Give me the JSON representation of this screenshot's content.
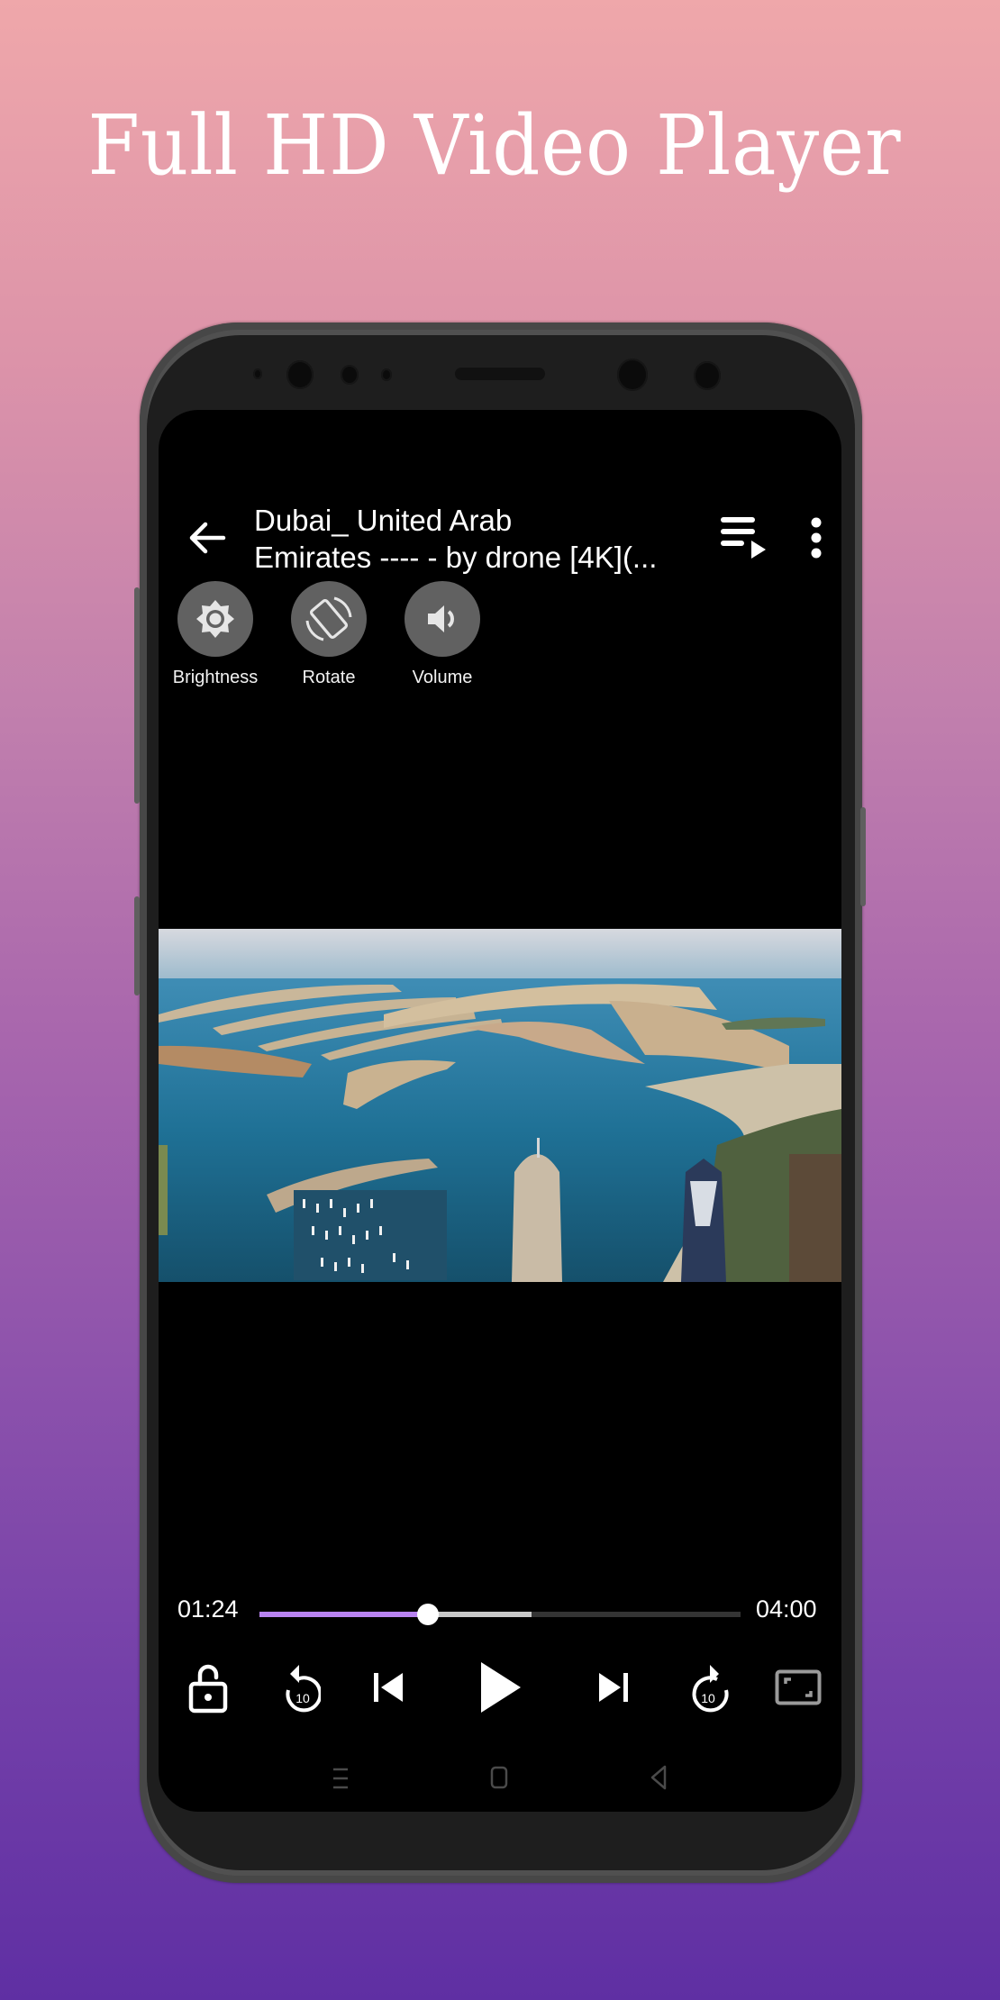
{
  "promo": {
    "headline": "Full HD Video Player"
  },
  "player": {
    "title_line1": "Dubai_ United Arab",
    "title_line2": "Emirates ---- - by drone [4K](...",
    "quick_actions": [
      {
        "label": "Brightness",
        "icon": "brightness-icon"
      },
      {
        "label": "Rotate",
        "icon": "rotate-icon"
      },
      {
        "label": "Volume",
        "icon": "volume-icon"
      }
    ],
    "video": {
      "description": "Aerial drone view of Palm Jumeirah and Dubai Marina"
    },
    "progress": {
      "current_time": "01:24",
      "total_time": "04:00",
      "played_fraction": 0.35,
      "buffered_fraction": 0.565
    },
    "controls": [
      {
        "name": "lock",
        "icon": "unlock-icon"
      },
      {
        "name": "rewind-10",
        "icon": "replay-10-icon",
        "badge": "10"
      },
      {
        "name": "previous",
        "icon": "skip-previous-icon"
      },
      {
        "name": "play",
        "icon": "play-icon"
      },
      {
        "name": "next",
        "icon": "skip-next-icon"
      },
      {
        "name": "forward-10",
        "icon": "forward-10-icon",
        "badge": "10"
      },
      {
        "name": "aspect-ratio",
        "icon": "aspect-ratio-icon"
      }
    ],
    "colors": {
      "accent": "#b883f1",
      "buffer": "#c9c9c9",
      "track": "#343434",
      "quick_action_bg": "#616161"
    }
  },
  "system_nav": {
    "keys": [
      "recents",
      "home",
      "back"
    ]
  }
}
